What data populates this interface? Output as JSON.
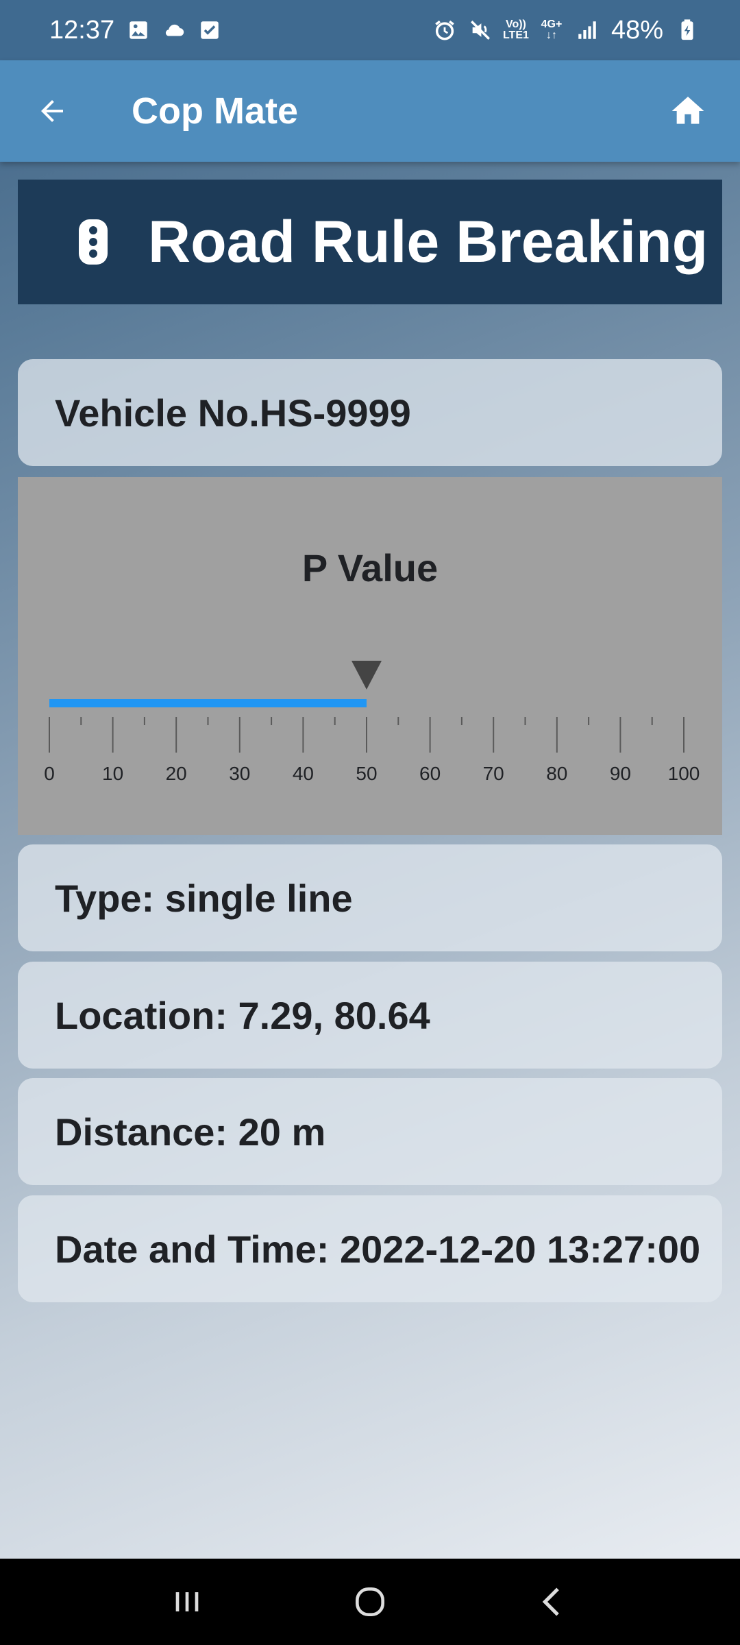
{
  "status_bar": {
    "time": "12:37",
    "battery": "48%",
    "network_top": "Vo))",
    "network_bottom": "LTE1",
    "network_type": "4G+",
    "left_icons": [
      "image-icon",
      "cloud-icon",
      "checkbox-icon"
    ],
    "right_icons": [
      "alarm-icon",
      "mute-icon",
      "signal-icon",
      "battery-charging-icon"
    ]
  },
  "app_bar": {
    "title": "Cop Mate",
    "back_icon": "arrow-left-icon",
    "home_icon": "home-icon"
  },
  "banner": {
    "icon": "traffic-light-icon",
    "title": "Road Rule Breaking"
  },
  "vehicle": {
    "label": "Vehicle No.HS-9999"
  },
  "gauge": {
    "title": "P Value",
    "min": 0,
    "max": 100,
    "value": 50,
    "major_tick_labels": [
      "0",
      "10",
      "20",
      "30",
      "40",
      "50",
      "60",
      "70",
      "80",
      "90",
      "100"
    ],
    "bar_color": "#2196f3",
    "pointer_color": "#444444"
  },
  "details": {
    "type": "Type: single line",
    "location": "Location: 7.29, 80.64",
    "distance": "Distance: 20 m",
    "datetime": "Date and Time: 2022-12-20 13:27:00"
  },
  "nav_bar": {
    "icons": [
      "recent-apps-icon",
      "home-circle-icon",
      "back-chevron-icon"
    ]
  }
}
